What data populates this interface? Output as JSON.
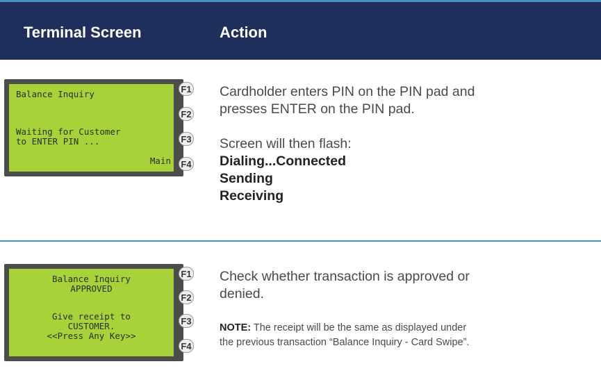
{
  "header": {
    "col_terminal": "Terminal Screen",
    "col_action": "Action"
  },
  "rows": [
    {
      "screen_lines": [
        "Balance Inquiry",
        "",
        "Waiting for Customer",
        "to ENTER PIN ...",
        "Main"
      ],
      "fkeys": [
        "F1",
        "F2",
        "F3",
        "F4"
      ],
      "action_lines": [
        "Cardholder enters PIN on the PIN pad and",
        "presses ENTER on the PIN pad."
      ],
      "flash_intro": "Screen will then flash:",
      "flash_items": [
        "Dialing...Connected",
        "Sending",
        "Receiving"
      ]
    },
    {
      "screen_lines": [
        "Balance Inquiry",
        "APPROVED",
        "Give receipt to",
        "CUSTOMER.",
        "<<Press Any Key>>"
      ],
      "fkeys": [
        "F1",
        "F2",
        "F3",
        "F4"
      ],
      "action_lines": [
        "Check whether transaction is approved or",
        "denied."
      ],
      "note_label": "NOTE:",
      "note_text_1": " The receipt will be the same as displayed under",
      "note_text_2": "the previous transaction “Balance Inquiry - Card Swipe”."
    }
  ],
  "colors": {
    "header_bg": "#1e2f5b",
    "rule": "#4a90c8",
    "lcd": "#a8d23a",
    "bezel": "#4b4d4b"
  }
}
